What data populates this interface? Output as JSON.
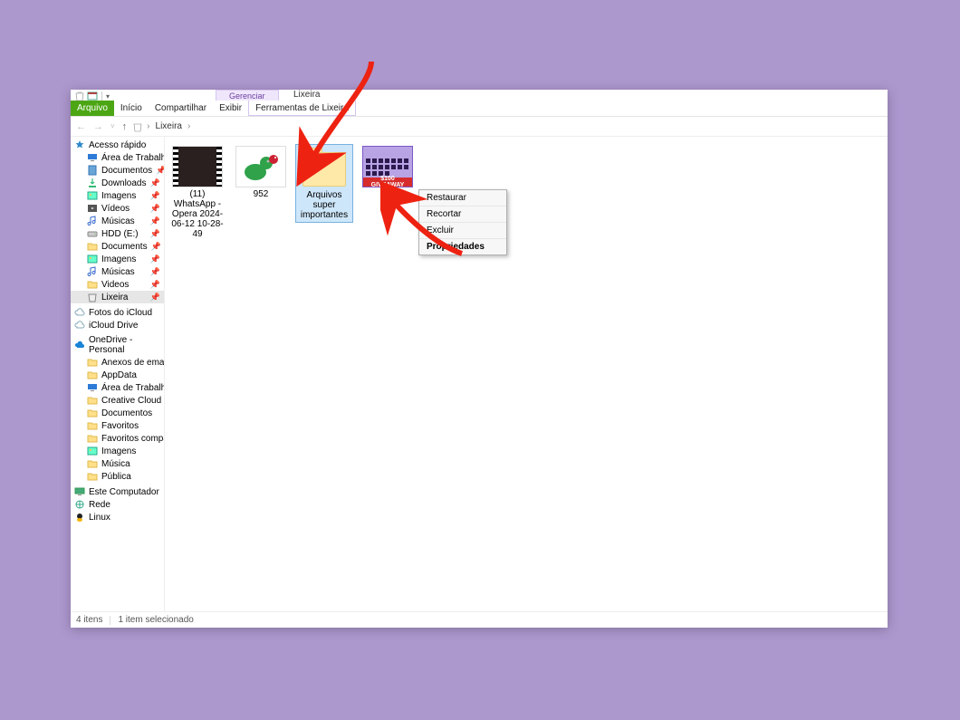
{
  "window": {
    "title": "Lixeira",
    "ctx_group_label": "Gerenciar",
    "ctx_tab_label": "Ferramentas de Lixeira"
  },
  "tabs": {
    "file": "Arquivo",
    "home": "Início",
    "share": "Compartilhar",
    "view": "Exibir"
  },
  "nav": {
    "back": "←",
    "forward": "→",
    "up": "↑",
    "crumb_root": "Lixeira",
    "crumb_sep": "›"
  },
  "sidebar": {
    "quick_access": {
      "label": "Acesso rápido",
      "items": [
        {
          "label": "Área de Trabalho",
          "icon": "desktop",
          "pinned": true
        },
        {
          "label": "Documentos",
          "icon": "doc",
          "pinned": true
        },
        {
          "label": "Downloads",
          "icon": "download",
          "pinned": true
        },
        {
          "label": "Imagens",
          "icon": "image",
          "pinned": true
        },
        {
          "label": "Vídeos",
          "icon": "video",
          "pinned": true
        },
        {
          "label": "Músicas",
          "icon": "music",
          "pinned": true
        },
        {
          "label": "HDD (E:)",
          "icon": "drive",
          "pinned": true
        },
        {
          "label": "Documents",
          "icon": "folder",
          "pinned": true
        },
        {
          "label": "Imagens",
          "icon": "image",
          "pinned": true
        },
        {
          "label": "Músicas",
          "icon": "music",
          "pinned": true
        },
        {
          "label": "Videos",
          "icon": "folder",
          "pinned": true
        },
        {
          "label": "Lixeira",
          "icon": "bin",
          "pinned": true,
          "selected": true
        }
      ]
    },
    "icloud_photos": {
      "label": "Fotos do iCloud"
    },
    "icloud_drive": {
      "label": "iCloud Drive"
    },
    "onedrive": {
      "label": "OneDrive - Personal",
      "items": [
        {
          "label": "Anexos de email",
          "icon": "folder"
        },
        {
          "label": "AppData",
          "icon": "folder"
        },
        {
          "label": "Área de Trabalho",
          "icon": "desktop"
        },
        {
          "label": "Creative Cloud Files",
          "icon": "folder"
        },
        {
          "label": "Documentos",
          "icon": "folder"
        },
        {
          "label": "Favoritos",
          "icon": "folder"
        },
        {
          "label": "Favoritos compartil",
          "icon": "folder"
        },
        {
          "label": "Imagens",
          "icon": "image"
        },
        {
          "label": "Música",
          "icon": "folder"
        },
        {
          "label": "Pública",
          "icon": "folder"
        }
      ]
    },
    "this_pc": {
      "label": "Este Computador"
    },
    "network": {
      "label": "Rede"
    },
    "linux": {
      "label": "Linux"
    }
  },
  "files": [
    {
      "label": "(11) WhatsApp - Opera 2024-06-12 10-28-49",
      "type": "video",
      "thumb_text": ""
    },
    {
      "label": "952",
      "type": "dino"
    },
    {
      "label": "Arquivos super importantes",
      "type": "folder",
      "selected": true
    },
    {
      "label": "",
      "type": "giveaway",
      "banner": "$100 GIVEAWAY"
    }
  ],
  "context_menu": [
    {
      "label": "Restaurar",
      "bold": false
    },
    {
      "label": "Recortar",
      "bold": false
    },
    {
      "label": "Excluir",
      "bold": false
    },
    {
      "label": "Propriedades",
      "bold": true
    }
  ],
  "status": {
    "count": "4 itens",
    "selection": "1 item selecionado"
  }
}
